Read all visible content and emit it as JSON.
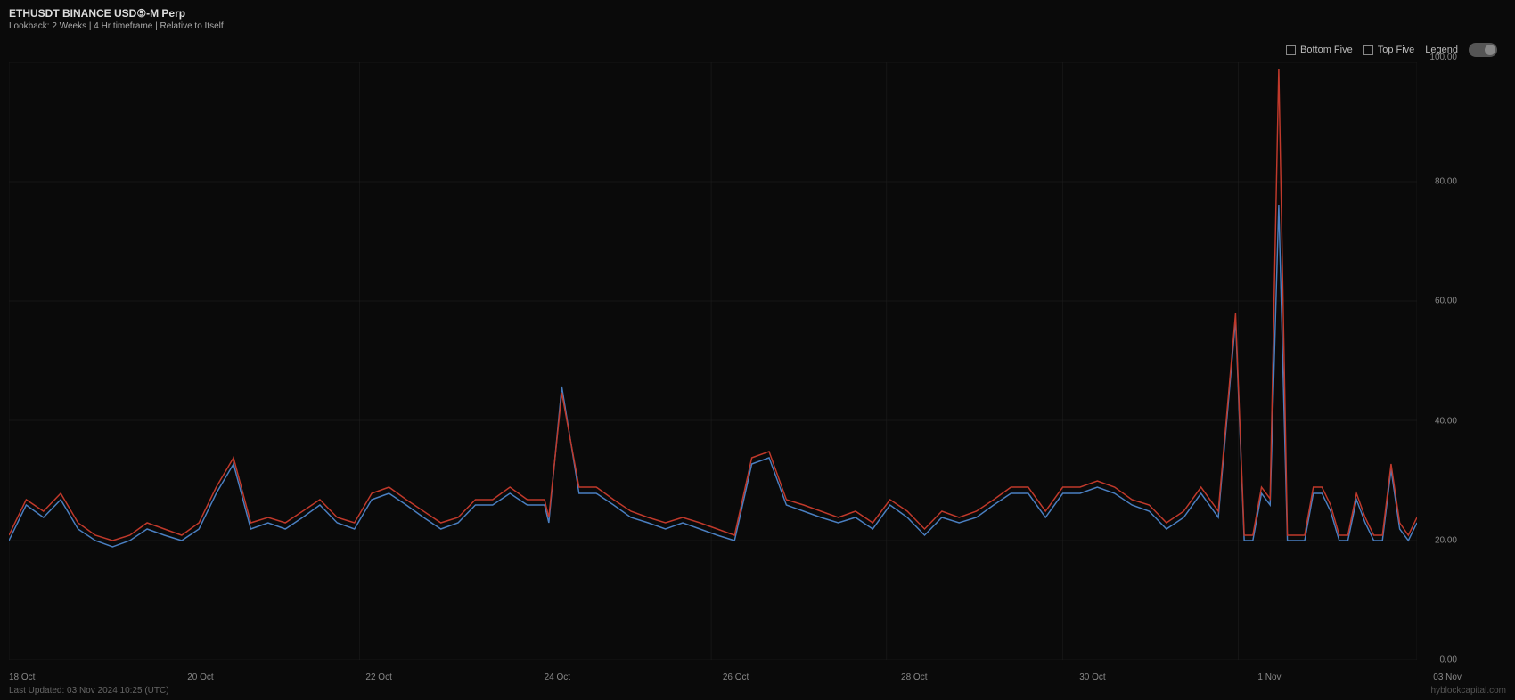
{
  "header": {
    "title": "ETHUSDT BINANCE USD⑤-M Perp",
    "subtitle": "Lookback: 2 Weeks | 4 Hr timeframe | Relative to Itself"
  },
  "legend": {
    "bottom_five_label": "Bottom Five",
    "top_five_label": "Top Five",
    "legend_label": "Legend"
  },
  "footer": {
    "last_updated": "Last Updated: 03 Nov 2024 10:25 (UTC)"
  },
  "watermark": {
    "text": "hyblockcapital.com"
  },
  "y_axis": {
    "labels": [
      "100.00",
      "80.00",
      "60.00",
      "40.00",
      "20.00",
      "0.00"
    ],
    "values": [
      100,
      80,
      60,
      40,
      20,
      0
    ]
  },
  "x_axis": {
    "labels": [
      "18 Oct",
      "20 Oct",
      "22 Oct",
      "24 Oct",
      "26 Oct",
      "28 Oct",
      "30 Oct",
      "1 Nov",
      "03 Nov"
    ]
  },
  "chart": {
    "colors": {
      "blue": "#4a7fc1",
      "red": "#c0392b",
      "grid": "#1e1e1e"
    }
  }
}
